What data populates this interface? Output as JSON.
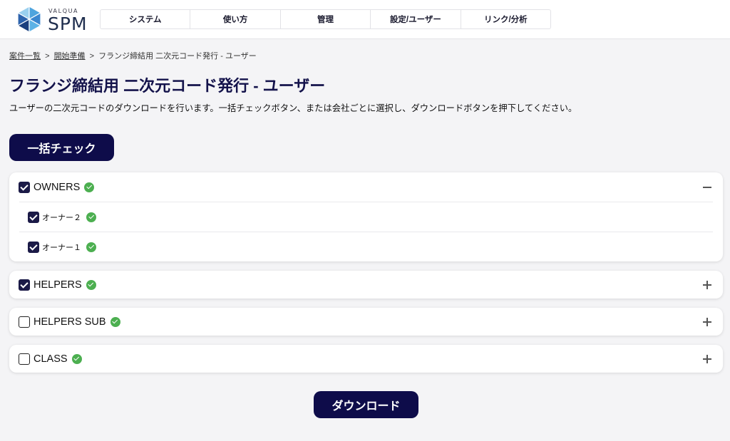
{
  "header": {
    "logo": {
      "brand": "VALQUA",
      "product": "SPM",
      "icon": "hexagon-cube-logo-icon"
    },
    "nav": [
      {
        "label": "システム"
      },
      {
        "label": "使い方"
      },
      {
        "label": "管理"
      },
      {
        "label": "設定/ユーザー"
      },
      {
        "label": "リンク/分析"
      }
    ]
  },
  "breadcrumb": {
    "separator": ">",
    "items": [
      {
        "label": "案件一覧",
        "link": true
      },
      {
        "label": "開始準備",
        "link": true
      },
      {
        "label": "フランジ締結用 二次元コード発行 - ユーザー",
        "link": false
      }
    ]
  },
  "page": {
    "title": "フランジ締結用 二次元コード発行 - ユーザー",
    "description": "ユーザーの二次元コードのダウンロードを行います。一括チェックボタン、または会社ごとに選択し、ダウンロードボタンを押下してください。"
  },
  "actions": {
    "bulk_check_label": "一括チェック",
    "download_label": "ダウンロード"
  },
  "groups": [
    {
      "name": "OWNERS",
      "checked": true,
      "expanded": true,
      "status_icon": "check-circle-icon",
      "toggle_icon": "minus-icon",
      "members": [
        {
          "name": "オーナー２",
          "checked": true,
          "status_icon": "check-circle-icon"
        },
        {
          "name": "オーナー１",
          "checked": true,
          "status_icon": "check-circle-icon"
        }
      ]
    },
    {
      "name": "HELPERS",
      "checked": true,
      "expanded": false,
      "status_icon": "check-circle-icon",
      "toggle_icon": "plus-icon"
    },
    {
      "name": "HELPERS SUB",
      "checked": false,
      "expanded": false,
      "status_icon": "check-circle-icon",
      "toggle_icon": "plus-icon"
    },
    {
      "name": "CLASS",
      "checked": false,
      "expanded": false,
      "status_icon": "check-circle-icon",
      "toggle_icon": "plus-icon"
    }
  ],
  "colors": {
    "primary": "#0e0c4a",
    "title": "#14134b",
    "page_background": "#f4f4f6",
    "success": "#4caf50",
    "checkbox": "#1b1a47"
  }
}
